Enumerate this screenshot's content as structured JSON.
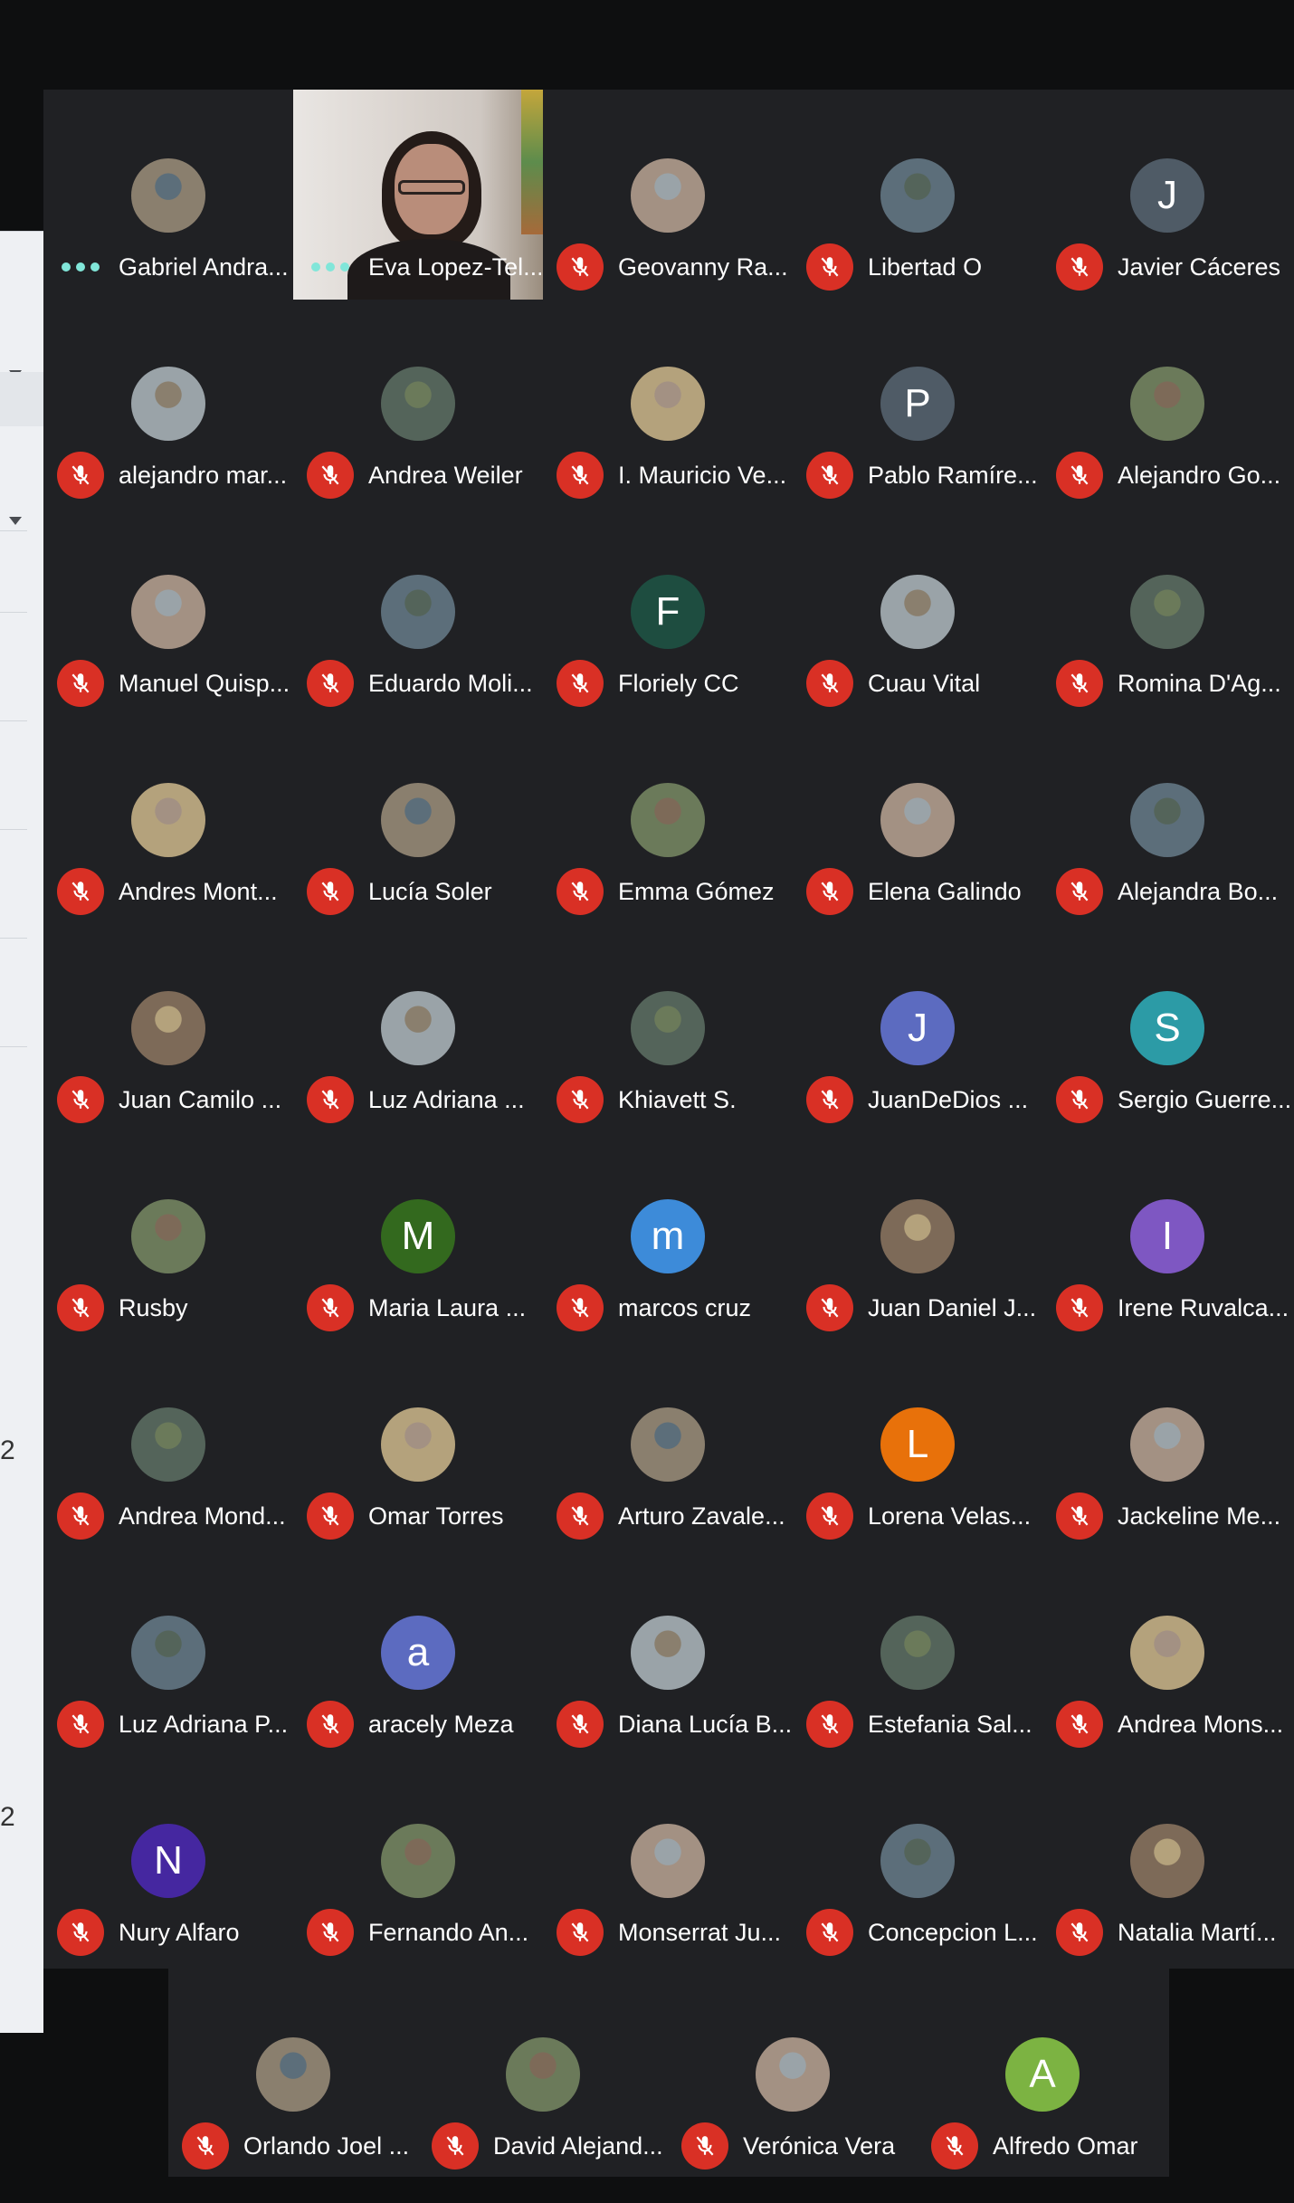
{
  "participants": [
    {
      "name": "Gabriel Andra...",
      "avatar": "photo",
      "status": "speaking"
    },
    {
      "name": "Eva Lopez-Tel...",
      "avatar": "video",
      "status": "speaking"
    },
    {
      "name": "Geovanny Ra...",
      "avatar": "photo",
      "status": "muted"
    },
    {
      "name": "Libertad O",
      "avatar": "photo",
      "status": "muted"
    },
    {
      "name": "Javier Cáceres",
      "initial": "J",
      "color": "#4f5b66",
      "status": "muted"
    },
    {
      "name": "alejandro mar...",
      "avatar": "photo",
      "status": "muted"
    },
    {
      "name": "Andrea Weiler",
      "avatar": "photo",
      "status": "muted"
    },
    {
      "name": "I. Mauricio Ve...",
      "avatar": "photo",
      "status": "muted"
    },
    {
      "name": "Pablo Ramíre...",
      "initial": "P",
      "color": "#4f5b66",
      "status": "muted"
    },
    {
      "name": "Alejandro Go...",
      "avatar": "photo",
      "status": "muted"
    },
    {
      "name": "Manuel Quisp...",
      "avatar": "photo",
      "status": "muted"
    },
    {
      "name": "Eduardo Moli...",
      "avatar": "photo",
      "status": "muted"
    },
    {
      "name": "Floriely CC",
      "initial": "F",
      "color": "#1e4d40",
      "status": "muted"
    },
    {
      "name": "Cuau Vital",
      "avatar": "photo",
      "status": "muted"
    },
    {
      "name": "Romina D'Ag...",
      "avatar": "photo",
      "status": "muted"
    },
    {
      "name": "Andres Mont...",
      "avatar": "photo",
      "status": "muted"
    },
    {
      "name": "Lucía Soler",
      "avatar": "photo",
      "status": "muted"
    },
    {
      "name": "Emma Gómez",
      "avatar": "photo",
      "status": "muted"
    },
    {
      "name": "Elena Galindo",
      "avatar": "photo",
      "status": "muted"
    },
    {
      "name": "Alejandra Bo...",
      "avatar": "photo",
      "status": "muted"
    },
    {
      "name": "Juan Camilo ...",
      "avatar": "photo",
      "status": "muted"
    },
    {
      "name": "Luz Adriana ...",
      "avatar": "photo",
      "status": "muted"
    },
    {
      "name": "Khiavett S.",
      "avatar": "photo",
      "status": "muted"
    },
    {
      "name": "JuanDeDios ...",
      "initial": "J",
      "color": "#5c6bc0",
      "status": "muted"
    },
    {
      "name": "Sergio Guerre...",
      "initial": "S",
      "color": "#2c9ba6",
      "status": "muted"
    },
    {
      "name": "Rusby",
      "avatar": "photo",
      "status": "muted"
    },
    {
      "name": "Maria Laura ...",
      "initial": "M",
      "color": "#33691e",
      "status": "muted"
    },
    {
      "name": "marcos cruz",
      "initial": "m",
      "color": "#3d8bd9",
      "status": "muted"
    },
    {
      "name": "Juan Daniel J...",
      "avatar": "photo",
      "status": "muted"
    },
    {
      "name": "Irene Ruvalca...",
      "initial": "I",
      "color": "#7e57c2",
      "status": "muted"
    },
    {
      "name": "Andrea Mond...",
      "avatar": "photo",
      "status": "muted"
    },
    {
      "name": "Omar Torres",
      "avatar": "photo",
      "status": "muted"
    },
    {
      "name": "Arturo Zavale...",
      "avatar": "photo",
      "status": "muted"
    },
    {
      "name": "Lorena Velas...",
      "initial": "L",
      "color": "#e8710a",
      "status": "muted"
    },
    {
      "name": "Jackeline Me...",
      "avatar": "photo",
      "status": "muted"
    },
    {
      "name": "Luz Adriana P...",
      "avatar": "photo",
      "status": "muted"
    },
    {
      "name": "aracely Meza",
      "initial": "a",
      "color": "#5c6bc0",
      "status": "muted"
    },
    {
      "name": "Diana Lucía B...",
      "avatar": "photo",
      "status": "muted"
    },
    {
      "name": "Estefania Sal...",
      "avatar": "photo",
      "status": "muted"
    },
    {
      "name": "Andrea Mons...",
      "avatar": "photo",
      "status": "muted"
    },
    {
      "name": "Nury Alfaro",
      "initial": "N",
      "color": "#4527a0",
      "status": "muted"
    },
    {
      "name": "Fernando An...",
      "avatar": "photo",
      "status": "muted"
    },
    {
      "name": "Monserrat Ju...",
      "avatar": "photo",
      "status": "muted"
    },
    {
      "name": "Concepcion L...",
      "avatar": "photo",
      "status": "muted"
    },
    {
      "name": "Natalia Martí...",
      "avatar": "photo",
      "status": "muted"
    }
  ],
  "bottom_row": [
    {
      "name": "Orlando Joel ...",
      "avatar": "photo",
      "status": "muted"
    },
    {
      "name": "David Alejand...",
      "avatar": "photo",
      "status": "muted"
    },
    {
      "name": "Verónica Vera",
      "avatar": "photo",
      "status": "muted"
    },
    {
      "name": "Alfredo Omar",
      "initial": "A",
      "color": "#7cb342",
      "status": "muted"
    }
  ],
  "background_window": {
    "digits": [
      "2",
      "2"
    ]
  },
  "colors": {
    "tile_bg": "#202124",
    "muted_red": "#d93025",
    "speaking_dots": "#81e6d9"
  }
}
